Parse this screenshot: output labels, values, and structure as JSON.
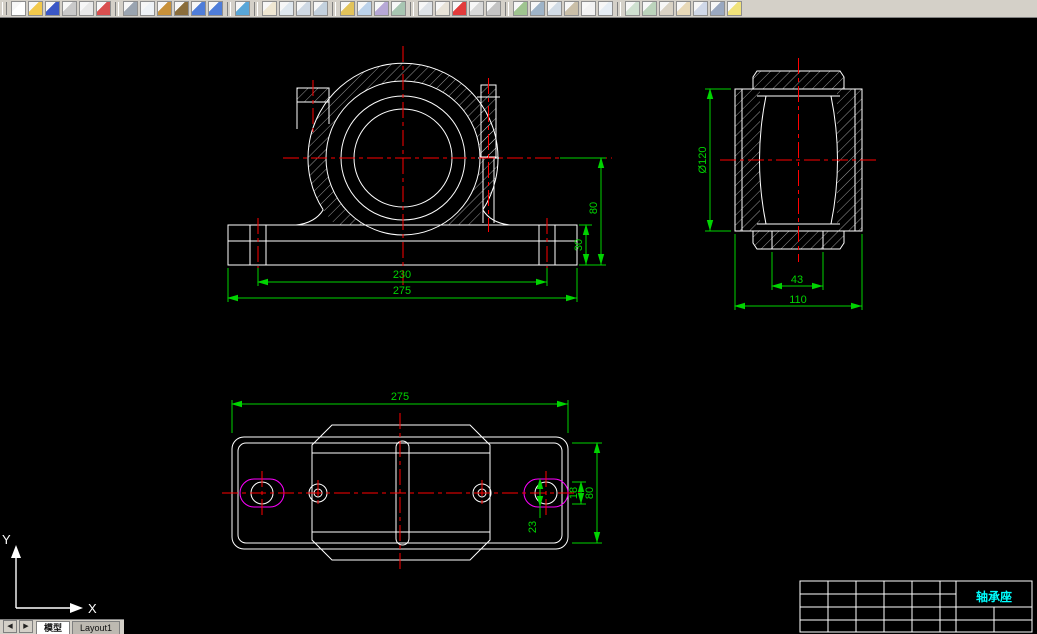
{
  "window": {
    "toolbar": {
      "icons": [
        {
          "name": "new",
          "color": "#ffffff"
        },
        {
          "name": "open",
          "color": "#f2c94c"
        },
        {
          "name": "save",
          "color": "#3a57c6"
        },
        {
          "name": "plot",
          "color": "#c9c9c9"
        },
        {
          "name": "print-preview",
          "color": "#e8e8e8"
        },
        {
          "name": "spelling",
          "color": "#d94f4f"
        },
        {
          "name": "separator"
        },
        {
          "name": "cut",
          "color": "#9aa4b0"
        },
        {
          "name": "copy",
          "color": "#eef2f6"
        },
        {
          "name": "paste",
          "color": "#c8913a"
        },
        {
          "name": "match-properties",
          "color": "#8a6d3b"
        },
        {
          "name": "undo",
          "color": "#4f7dd9"
        },
        {
          "name": "redo",
          "color": "#4f7dd9"
        },
        {
          "name": "separator"
        },
        {
          "name": "insert-hyperlink",
          "color": "#58a6d8"
        },
        {
          "name": "separator"
        },
        {
          "name": "pan-realtime",
          "color": "#efe7d2"
        },
        {
          "name": "zoom-realtime",
          "color": "#dfe7ee"
        },
        {
          "name": "zoom-window",
          "color": "#cfd9e4"
        },
        {
          "name": "zoom-previous",
          "color": "#c3d1de"
        },
        {
          "name": "separator"
        },
        {
          "name": "distance",
          "color": "#e2c35a"
        },
        {
          "name": "properties",
          "color": "#bcd2ea"
        },
        {
          "name": "design-center",
          "color": "#b7a8d6"
        },
        {
          "name": "tool-palettes",
          "color": "#a8c6b2"
        },
        {
          "name": "separator"
        },
        {
          "name": "layers",
          "color": "#dfe3e8"
        },
        {
          "name": "layer-previous",
          "color": "#e8e3d8"
        },
        {
          "name": "color-control",
          "color": "#e23b3b"
        },
        {
          "name": "linetype-control",
          "color": "#d8d8d8"
        },
        {
          "name": "lineweight-control",
          "color": "#c4c4c4"
        },
        {
          "name": "separator"
        },
        {
          "name": "make-block",
          "color": "#9fc48f"
        },
        {
          "name": "insert-block",
          "color": "#9fb4c8"
        },
        {
          "name": "hatch",
          "color": "#d2dce6"
        },
        {
          "name": "region",
          "color": "#cabfa8"
        },
        {
          "name": "text",
          "color": "#f2f2f2"
        },
        {
          "name": "table",
          "color": "#e6edf4"
        },
        {
          "name": "separator"
        },
        {
          "name": "named-views",
          "color": "#cfe0d0"
        },
        {
          "name": "3d-orbit",
          "color": "#bcd4bc"
        },
        {
          "name": "regen",
          "color": "#d9d2c4"
        },
        {
          "name": "osnap-settings",
          "color": "#e8d9b8"
        },
        {
          "name": "ucs",
          "color": "#d0d8e8"
        },
        {
          "name": "render",
          "color": "#9aa8c0"
        },
        {
          "name": "help",
          "color": "#f0e27a"
        }
      ]
    },
    "tab_bar": {
      "prev_label": "◀",
      "next_label": "▶",
      "tabs": [
        {
          "label": "模型",
          "active": true
        },
        {
          "label": "Layout1",
          "active": false
        }
      ]
    }
  },
  "drawing": {
    "front_view": {
      "dim_bolt_spacing": "230",
      "dim_base_width": "275",
      "dim_base_height": "30",
      "dim_center_height": "80"
    },
    "side_view": {
      "dim_bore": "Ø120",
      "dim_neck_width": "43",
      "dim_overall_width": "110"
    },
    "plan_view": {
      "dim_length": "275",
      "dim_slot_pitch": "18",
      "dim_plate_width": "80",
      "dim_slot_width": "23"
    },
    "ucs": {
      "x_label": "X",
      "y_label": "Y"
    },
    "title_block": {
      "part_name": "轴承座"
    }
  },
  "colors": {
    "background": "#000000",
    "object_lines": "#ffffff",
    "center_lines": "#ff0000",
    "dimensions": "#00d400",
    "slots": "#ff00ff",
    "title_text": "#00ffff",
    "toolbar_bg": "#d4d0c8"
  }
}
